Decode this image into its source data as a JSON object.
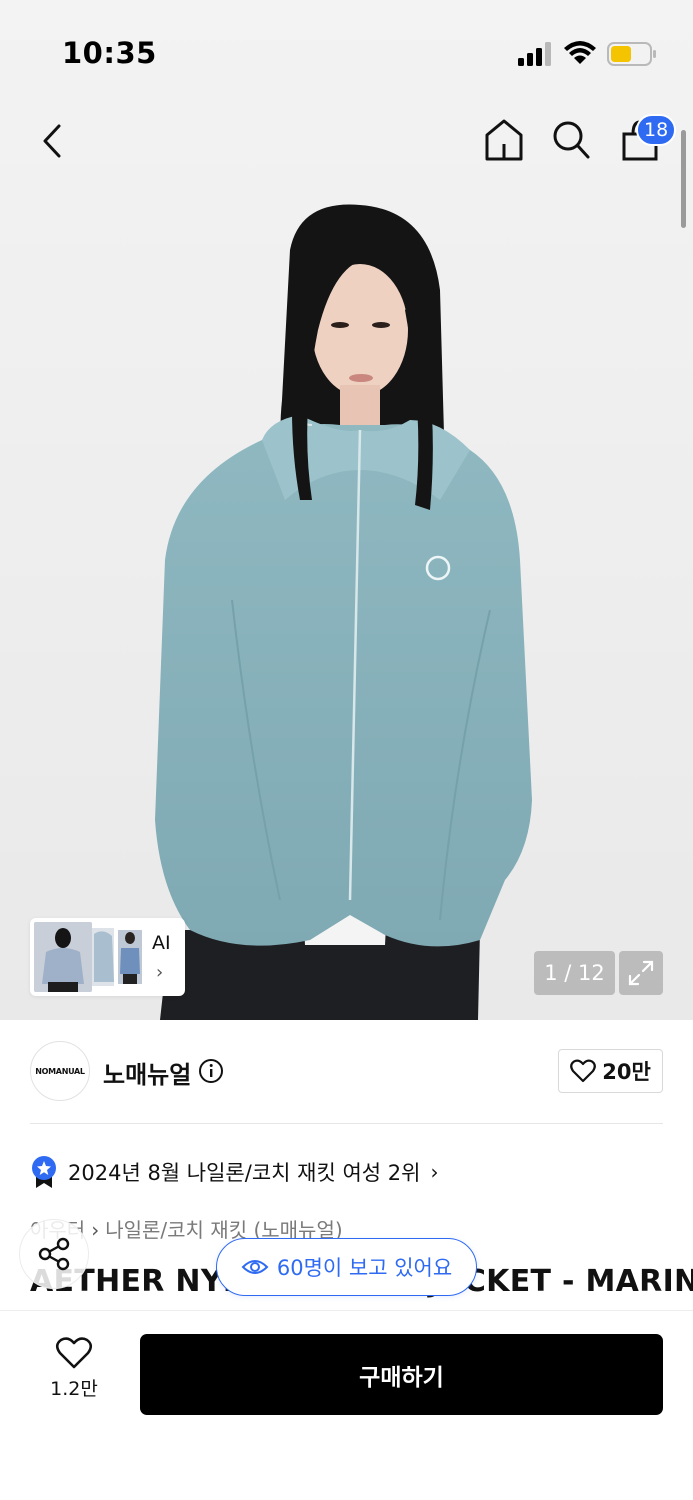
{
  "status_bar": {
    "time": "10:35",
    "icons": [
      "cellular-signal-icon",
      "wifi-icon",
      "battery-icon"
    ],
    "battery_color": "#f5c400"
  },
  "nav": {
    "icons": [
      "back-arrow-icon",
      "home-icon",
      "search-icon",
      "shopping-bag-icon"
    ],
    "cart_count": "18",
    "badge_color": "#2f6bf2"
  },
  "gallery": {
    "thumbnail_label": "AI",
    "page_counter": "1 / 12"
  },
  "brand": {
    "logo_text": "NOMANUAL",
    "name": "노매뉴얼",
    "likes": "20만"
  },
  "ranking": {
    "text": "2024년 8월 나일론/코치 재킷 여성 2위"
  },
  "category": {
    "parent": "아우터",
    "child": "나일론/코치 재킷 (노매뉴얼)"
  },
  "product": {
    "title": "AETHER NYLON ZIP-UP JACKET - MARINA"
  },
  "viewers": {
    "text": "60명이 보고 있어요"
  },
  "actions": {
    "wish_count": "1.2만",
    "buy_label": "구매하기"
  },
  "colors": {
    "accent": "#2f6bf2",
    "buy_button": "#000000"
  }
}
